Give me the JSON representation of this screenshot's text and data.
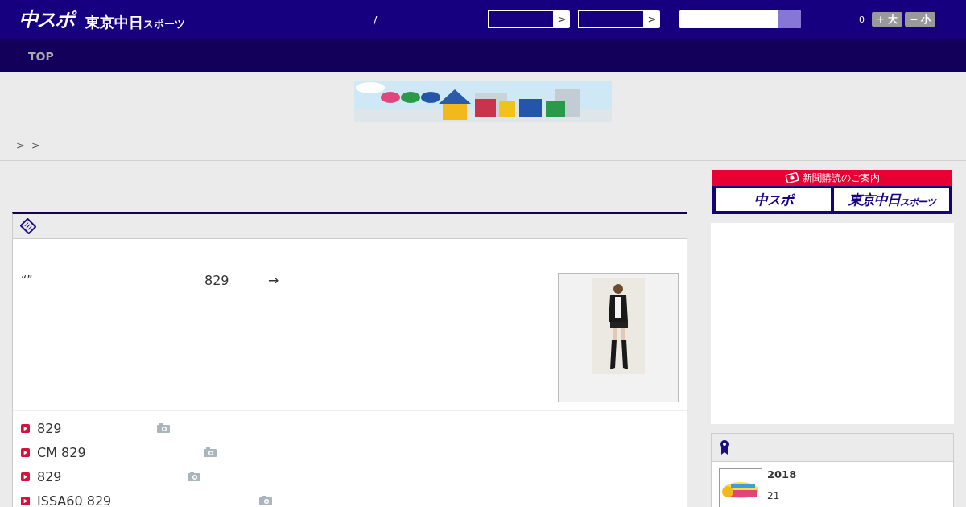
{
  "header": {
    "logo": "中スポ",
    "logo_sub": "東京中日",
    "logo_sub_small": "スポーツ",
    "separator": "/",
    "selects": [
      {
        "arrow": ">"
      },
      {
        "arrow": ">"
      }
    ],
    "count": "0",
    "font_buttons": [
      "+ 大",
      "− 小"
    ]
  },
  "nav": {
    "items": [
      {
        "label": "TOP",
        "selected": false
      }
    ]
  },
  "breadcrumb": [
    ">",
    ">"
  ],
  "article": {
    "quote": "“”",
    "number": "829",
    "arrow": "→",
    "links": [
      {
        "text": "829"
      },
      {
        "text": "CM 829"
      },
      {
        "text": "829"
      },
      {
        "text": "ISSA60 829"
      }
    ]
  },
  "subscribe": {
    "title": "新聞購読のご案内",
    "buttons": [
      {
        "main": "中スポ"
      },
      {
        "main": "東京中日",
        "small": "スポーツ"
      }
    ]
  },
  "ranking": {
    "items": [
      {
        "title": "2018",
        "sub": "21"
      }
    ]
  }
}
